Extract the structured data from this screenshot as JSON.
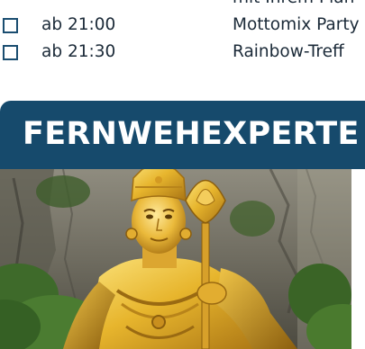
{
  "schedule": {
    "partial_row": {
      "event": "mit Ihrem Plan"
    },
    "rows": [
      {
        "time": "ab 21:00",
        "event": "Mottomix Party"
      },
      {
        "time": "ab 21:30",
        "event": "Rainbow-Treff"
      }
    ]
  },
  "section": {
    "title": "FERNWEHEXPERTE"
  },
  "photo": {
    "subject": "golden-statue-photo"
  },
  "colors": {
    "accent": "#164a6c",
    "checkbox_border": "#1a4d70",
    "text": "#1b2a38"
  }
}
